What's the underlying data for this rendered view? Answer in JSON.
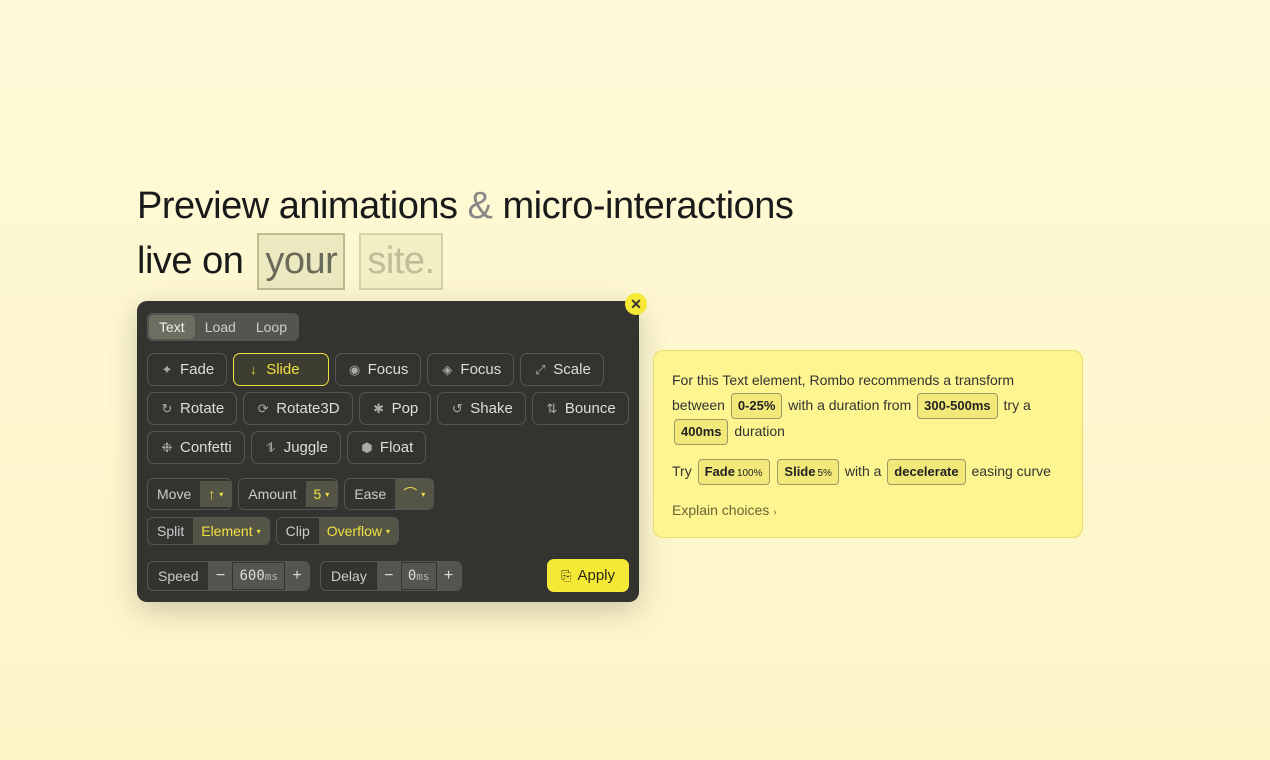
{
  "headline": {
    "line1a": "Preview animations",
    "amp": "&",
    "line1b": "micro-interactions",
    "line2": "live on",
    "box1": "your",
    "box2": "site."
  },
  "panel": {
    "close": "✕",
    "tabs": [
      "Text",
      "Load",
      "Loop"
    ],
    "active_tab": "Text",
    "effects": [
      {
        "icon": "✦",
        "label": "Fade",
        "selected": false
      },
      {
        "icon": "↓",
        "label": "Slide",
        "selected": true
      },
      {
        "icon": "◉",
        "label": "Focus",
        "selected": false
      },
      {
        "icon": "◈",
        "label": "Focus",
        "selected": false
      },
      {
        "icon": "⤢",
        "label": "Scale",
        "selected": false
      },
      {
        "icon": "↻",
        "label": "Rotate",
        "selected": false
      },
      {
        "icon": "⟳",
        "label": "Rotate3D",
        "selected": false
      },
      {
        "icon": "✱",
        "label": "Pop",
        "selected": false
      },
      {
        "icon": "↺",
        "label": "Shake",
        "selected": false
      },
      {
        "icon": "⇅",
        "label": "Bounce",
        "selected": false
      },
      {
        "icon": "❉",
        "label": "Confetti",
        "selected": false
      },
      {
        "icon": "⥮",
        "label": "Juggle",
        "selected": false
      },
      {
        "icon": "⬢",
        "label": "Float",
        "selected": false
      }
    ],
    "controls": {
      "move": {
        "label": "Move",
        "value": "↑"
      },
      "amount": {
        "label": "Amount",
        "value": "5"
      },
      "ease": {
        "label": "Ease",
        "value": "⌒"
      },
      "split": {
        "label": "Split",
        "value": "Element"
      },
      "clip": {
        "label": "Clip",
        "value": "Overflow"
      }
    },
    "speed": {
      "label": "Speed",
      "value": "600",
      "unit": "ms"
    },
    "delay": {
      "label": "Delay",
      "value": "0",
      "unit": "ms"
    },
    "apply": "Apply"
  },
  "rec": {
    "line1_a": "For this Text element, Rombo recommends a transform between",
    "pill_range": "0-25%",
    "line1_b": "with a duration from",
    "pill_duration": "300-500ms",
    "line1_c": "try a",
    "pill_try": "400ms",
    "line1_d": "duration",
    "line2_a": "Try",
    "pill_fade": "Fade",
    "pill_fade_pct": "100%",
    "pill_slide": "Slide",
    "pill_slide_pct": "5%",
    "line2_b": "with a",
    "pill_decel": "decelerate",
    "line2_c": "easing curve",
    "explain": "Explain choices"
  }
}
